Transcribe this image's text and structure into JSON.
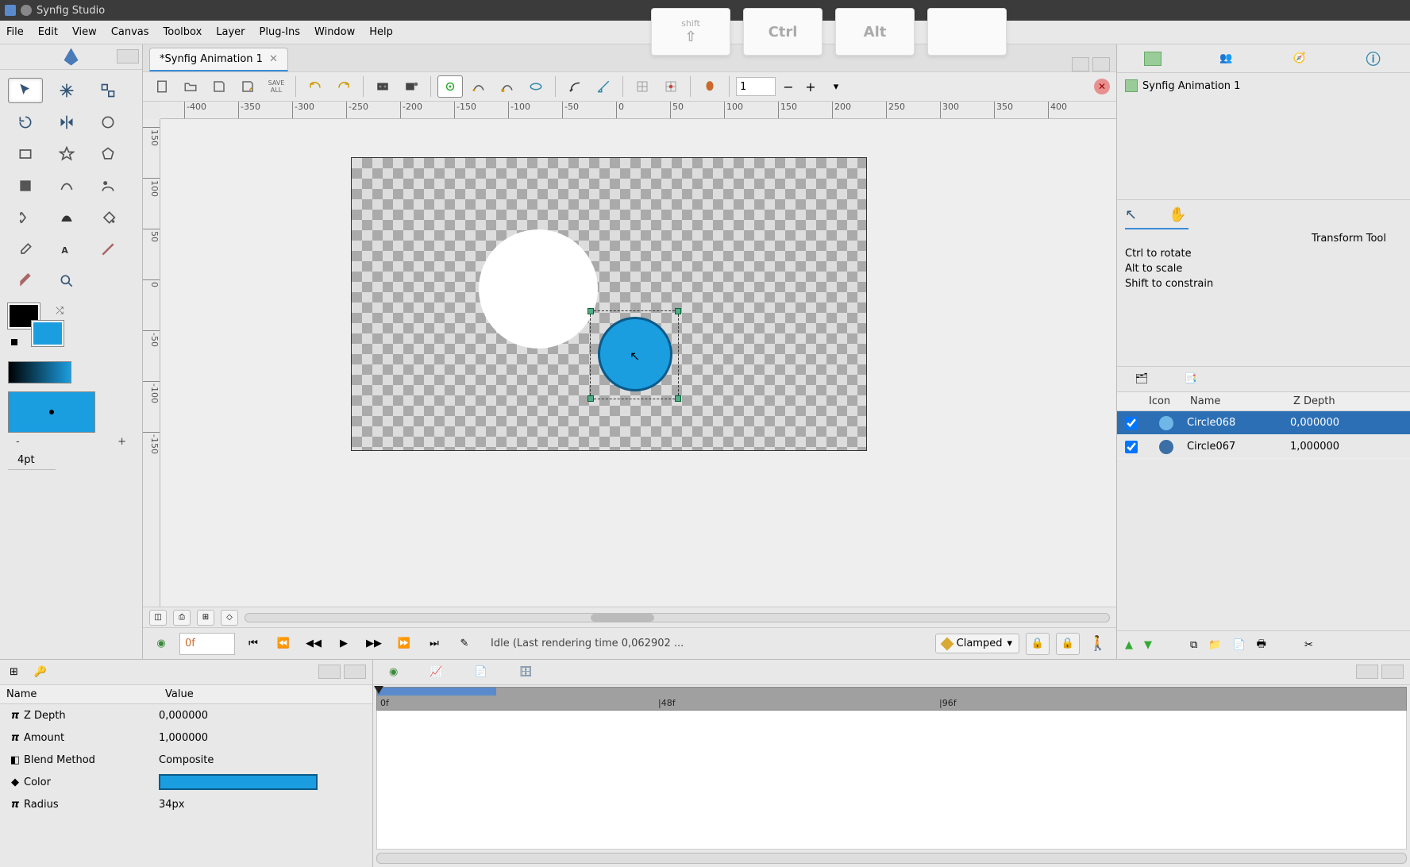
{
  "window": {
    "title": "Synfig Studio"
  },
  "menu": {
    "file": "File",
    "edit": "Edit",
    "view": "View",
    "canvas": "Canvas",
    "toolbox": "Toolbox",
    "layer": "Layer",
    "plugins": "Plug-Ins",
    "window": "Window",
    "help": "Help"
  },
  "keys": {
    "shift": "shift",
    "ctrl": "Ctrl",
    "alt": "Alt"
  },
  "tab": {
    "title": "*Synfig Animation 1",
    "close": "✕"
  },
  "toolbar": {
    "save_all": "SAVE\nALL",
    "zoom": "1",
    "minus": "−",
    "plus": "+"
  },
  "ruler_h": [
    "-400",
    "-350",
    "-300",
    "-250",
    "-200",
    "-150",
    "-100",
    "-50",
    "0",
    "50",
    "100",
    "150",
    "200",
    "250",
    "300",
    "350",
    "400"
  ],
  "ruler_v": [
    "150",
    "100",
    "50",
    "0",
    "-50",
    "-100",
    "-150"
  ],
  "brush": {
    "minus": "-",
    "plus": "+",
    "size": "4pt"
  },
  "playbar": {
    "frame": "0f",
    "status": "Idle (Last rendering time 0,062902 ...",
    "interp": "Clamped"
  },
  "right": {
    "doc": "Synfig Animation 1",
    "tool_title": "Transform Tool",
    "tip1": "Ctrl to rotate",
    "tip2": "Alt to scale",
    "tip3": "Shift to constrain"
  },
  "layers": {
    "hdr_icon": "Icon",
    "hdr_name": "Name",
    "hdr_z": "Z Depth",
    "rows": [
      {
        "name": "Circle068",
        "z": "0,000000",
        "color": "#6fb7e6",
        "sel": true
      },
      {
        "name": "Circle067",
        "z": "1,000000",
        "color": "#3b6fa5",
        "sel": false
      }
    ]
  },
  "params": {
    "hdr_name": "Name",
    "hdr_val": "Value",
    "rows": [
      {
        "ico": "π",
        "name": "Z Depth",
        "val": "0,000000"
      },
      {
        "ico": "π",
        "name": "Amount",
        "val": "1,000000"
      },
      {
        "ico": "◧",
        "name": "Blend Method",
        "val": "Composite"
      },
      {
        "ico": "◆",
        "name": "Color",
        "val": "__COLOR__"
      },
      {
        "ico": "π",
        "name": "Radius",
        "val": "34px"
      }
    ]
  },
  "timeline": {
    "labels": [
      "0f",
      "|48f",
      "|96f"
    ]
  }
}
